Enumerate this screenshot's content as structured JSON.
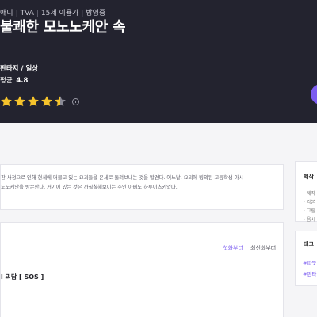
{
  "hero": {
    "meta": [
      "애니",
      "TVA",
      "15세 이용가",
      "방영중"
    ],
    "title": "불쾌한 모노노케안 속",
    "genre": "판타지 / 일상",
    "rating_label": "평균",
    "rating_value": "4.8",
    "stars_filled": 4.5,
    "colors": {
      "background": "#23232f",
      "star": "#f5c32c",
      "accent": "#7b5cf0"
    }
  },
  "synopsis": {
    "line1": "판 사정으로 인해 현세에 머물고 있는 요괴들을 은세로 돌려보내는 것을 발견다. 어느날, 요괴에 빙의된 고등학생 아시",
    "line2": "노노케안을 방문한다. 거기에 있는 것은 까칠칠해보이는 주인 아베노 하루이츠키였다."
  },
  "episodes": {
    "sort_first": "첫화부터",
    "sort_latest": "최신화부터",
    "episode_title": "l 괴담 [ SOS ]"
  },
  "side": {
    "production_header": "제작",
    "production_items": [
      "· 제작",
      "· 각본",
      "· 그림",
      "· 음시"
    ],
    "tag_header": "태그",
    "tags": [
      "#따뜻",
      "#판타"
    ]
  }
}
